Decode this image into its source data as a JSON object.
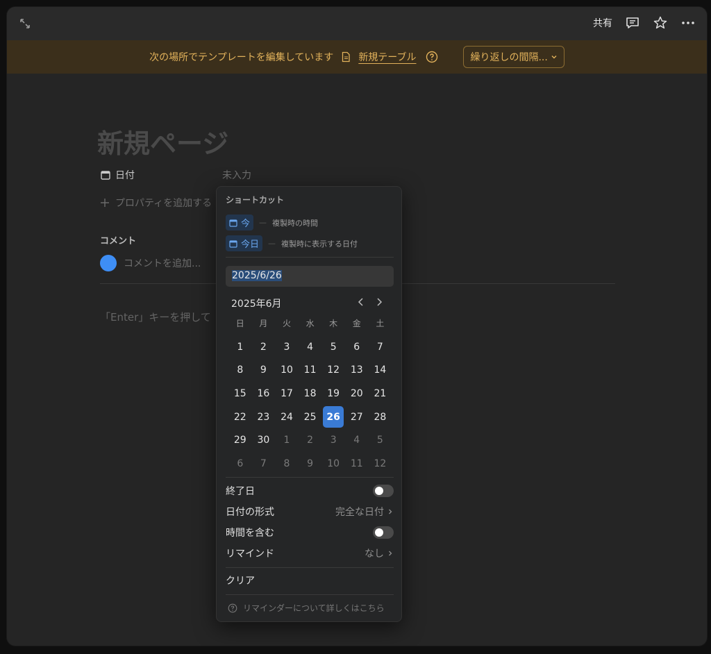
{
  "topbar": {
    "share_label": "共有",
    "icons": [
      "expand-icon",
      "comment-icon",
      "star-icon",
      "more-icon"
    ]
  },
  "banner": {
    "text": "次の場所でテンプレートを編集しています",
    "link_label": "新規テーブル",
    "repeat_label": "繰り返しの間隔...",
    "color": "#e2b25b",
    "background": "#3b2f1b"
  },
  "page": {
    "title": "新規ページ",
    "property_name": "日付",
    "property_value": "未入力",
    "add_property_label": "プロパティを追加する",
    "comments_heading": "コメント",
    "comment_placeholder": "コメントを追加...",
    "body_hint": "「Enter」キーを押して"
  },
  "date_popup": {
    "shortcuts_heading": "ショートカット",
    "shortcuts": [
      {
        "chip": "今",
        "description": "複製時の時間"
      },
      {
        "chip": "今日",
        "description": "複製時に表示する日付"
      }
    ],
    "date_input": "2025/6/26",
    "month_label": "2025年6月",
    "weekdays": [
      "日",
      "月",
      "火",
      "水",
      "木",
      "金",
      "土"
    ],
    "days": [
      [
        "1",
        "2",
        "3",
        "4",
        "5",
        "6",
        "7"
      ],
      [
        "8",
        "9",
        "10",
        "11",
        "12",
        "13",
        "14"
      ],
      [
        "15",
        "16",
        "17",
        "18",
        "19",
        "20",
        "21"
      ],
      [
        "22",
        "23",
        "24",
        "25",
        "26",
        "27",
        "28"
      ],
      [
        "29",
        "30",
        "1",
        "2",
        "3",
        "4",
        "5"
      ],
      [
        "6",
        "7",
        "8",
        "9",
        "10",
        "11",
        "12"
      ]
    ],
    "muted_from_index": 30,
    "selected_day": "26",
    "end_date_label": "終了日",
    "end_date_on": false,
    "date_format_label": "日付の形式",
    "date_format_value": "完全な日付",
    "include_time_label": "時間を含む",
    "include_time_on": false,
    "remind_label": "リマインド",
    "remind_value": "なし",
    "clear_label": "クリア",
    "help_text": "リマインダーについて詳しくはこちら",
    "accent": "#3a7bd5"
  }
}
